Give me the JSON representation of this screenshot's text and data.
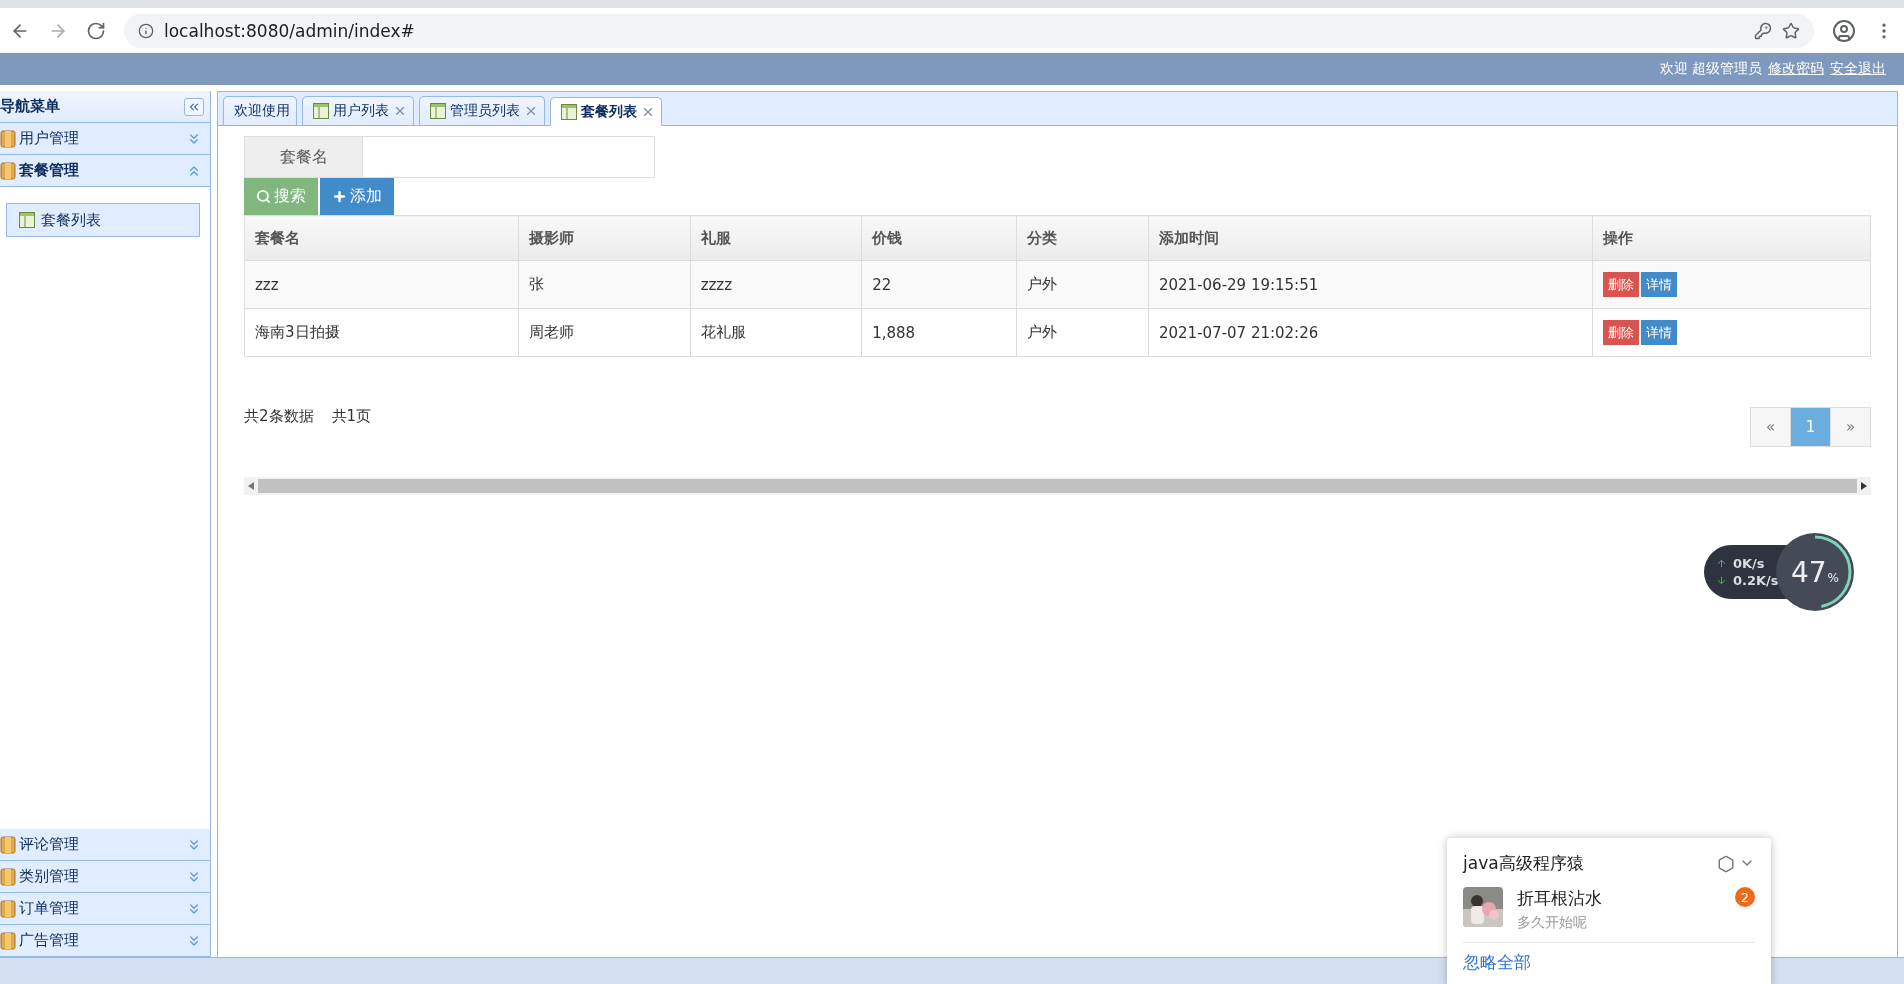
{
  "browser": {
    "url": "localhost:8080/admin/index#"
  },
  "header": {
    "welcome": "欢迎 超级管理员",
    "links": [
      "修改密码",
      "安全退出"
    ]
  },
  "sidebar": {
    "title": "导航菜单",
    "groups": [
      {
        "label": "用户管理",
        "expanded": false
      },
      {
        "label": "套餐管理",
        "expanded": true,
        "children": [
          {
            "label": "套餐列表",
            "selected": true
          }
        ]
      },
      {
        "label": "评论管理",
        "expanded": false
      },
      {
        "label": "类别管理",
        "expanded": false
      },
      {
        "label": "订单管理",
        "expanded": false
      },
      {
        "label": "广告管理",
        "expanded": false
      }
    ]
  },
  "tabs": [
    {
      "label": "欢迎使用",
      "selected": false,
      "closable": false
    },
    {
      "label": "用户列表",
      "selected": false,
      "closable": true
    },
    {
      "label": "管理员列表",
      "selected": false,
      "closable": true
    },
    {
      "label": "套餐列表",
      "selected": true,
      "closable": true
    }
  ],
  "search": {
    "label": "套餐名",
    "buttons": [
      "搜索",
      "添加"
    ]
  },
  "table": {
    "columns": [
      "套餐名",
      "摄影师",
      "礼服",
      "价钱",
      "分类",
      "添加时间",
      "操作"
    ],
    "rows": [
      {
        "cells": [
          "zzz",
          "张",
          "zzzz",
          "22",
          "户外",
          "2021-06-29 19:15:51"
        ],
        "actions": [
          "删除",
          "详情"
        ]
      },
      {
        "cells": [
          "海南3日拍摄",
          "周老师",
          "花礼服",
          "1,888",
          "户外",
          "2021-07-07 21:02:26"
        ],
        "actions": [
          "删除",
          "详情"
        ]
      }
    ]
  },
  "pagination": {
    "summary": [
      "共2条数据",
      "共1页"
    ],
    "prev": "«",
    "pages": [
      {
        "label": "1",
        "selected": true
      }
    ],
    "next": "»"
  },
  "speed_widget": {
    "upload": "0",
    "upload_unit": "K/s",
    "download": "0.2",
    "download_unit": "K/s",
    "percent": "47",
    "percent_sign": "%",
    "level": 0.47
  },
  "notification": {
    "title": "java高级程序猿",
    "sender": "折耳根沾水",
    "message": "多久开始呢",
    "badge": "2",
    "footer": "忽略全部"
  }
}
